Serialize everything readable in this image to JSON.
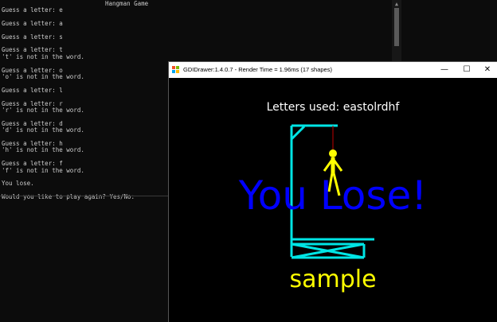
{
  "console": {
    "title": "Hangman Game",
    "lines": [
      "Guess a letter: e",
      "",
      "Guess a letter: a",
      "",
      "Guess a letter: s",
      "",
      "Guess a letter: t",
      "'t' is not in the word.",
      "",
      "Guess a letter: o",
      "'o' is not in the word.",
      "",
      "Guess a letter: l",
      "",
      "Guess a letter: r",
      "'r' is not in the word.",
      "",
      "Guess a letter: d",
      "'d' is not in the word.",
      "",
      "Guess a letter: h",
      "'h' is not in the word.",
      "",
      "Guess a letter: f",
      "'f' is not in the word.",
      "",
      "You lose.",
      "",
      "Would you like to play again? Yes/No:"
    ]
  },
  "drawer": {
    "window_title": "GDIDrawer:1.4.0.7 - Render Time = 1.96ms (17 shapes)",
    "letters_used": "Letters used: eastolrdhf",
    "result": "You Lose!",
    "word": "sample",
    "colors": {
      "gallows": "#00e5e5",
      "rope": "#c00000",
      "figure": "#ffff00",
      "result": "#0000ff",
      "word": "#ffff00",
      "letters": "#ffffff"
    },
    "window_buttons": {
      "minimize": "—",
      "maximize": "☐",
      "close": "✕"
    }
  }
}
